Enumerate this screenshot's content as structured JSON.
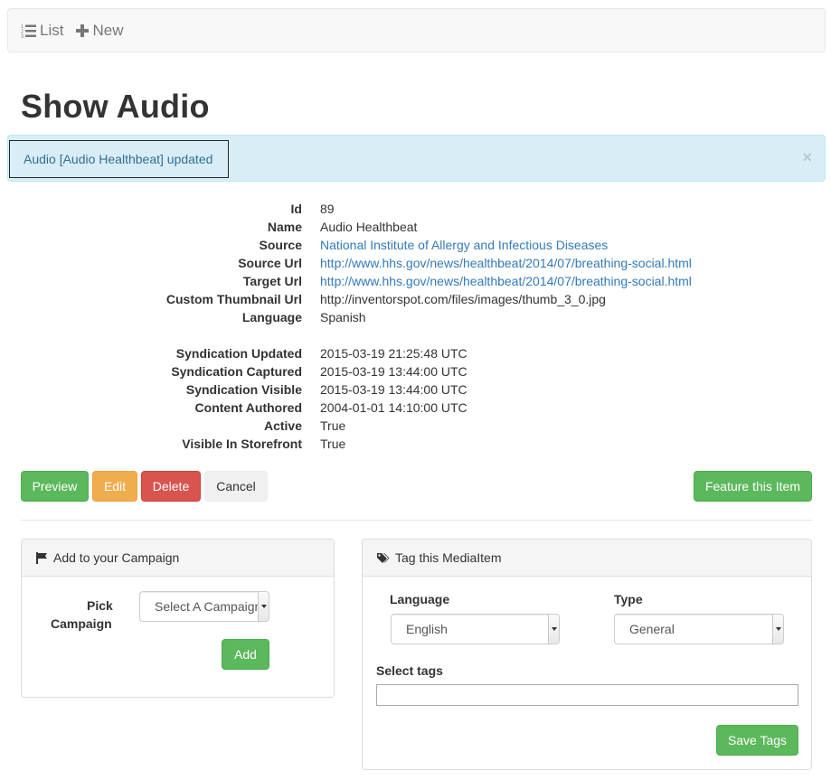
{
  "nav": {
    "list_label": "List",
    "new_label": "New"
  },
  "page_title": "Show Audio",
  "alert": {
    "message": "Audio [Audio Healthbeat] updated",
    "close_glyph": "×"
  },
  "details": [
    {
      "label": "Id",
      "value": "89"
    },
    {
      "label": "Name",
      "value": "Audio Healthbeat"
    },
    {
      "label": "Source",
      "value": "National Institute of Allergy and Infectious Diseases"
    },
    {
      "label": "Source Url",
      "value": "http://www.hhs.gov/news/healthbeat/2014/07/breathing-social.html"
    },
    {
      "label": "Target Url",
      "value": "http://www.hhs.gov/news/healthbeat/2014/07/breathing-social.html"
    },
    {
      "label": "Custom Thumbnail Url",
      "value": "http://inventorspot.com/files/images/thumb_3_0.jpg"
    },
    {
      "label": "Language",
      "value": "Spanish"
    },
    {
      "label": "Syndication Updated",
      "value": "2015-03-19 21:25:48 UTC"
    },
    {
      "label": "Syndication Captured",
      "value": "2015-03-19 13:44:00 UTC"
    },
    {
      "label": "Syndication Visible",
      "value": "2015-03-19 13:44:00 UTC"
    },
    {
      "label": "Content Authored",
      "value": "2004-01-01 14:10:00 UTC"
    },
    {
      "label": "Active",
      "value": "True"
    },
    {
      "label": "Visible In Storefront",
      "value": "True"
    }
  ],
  "actions": {
    "preview": "Preview",
    "edit": "Edit",
    "delete": "Delete",
    "cancel": "Cancel",
    "feature": "Feature this Item"
  },
  "campaign_panel": {
    "title": "Add to your Campaign",
    "pick_label_line1": "Pick",
    "pick_label_line2": "Campaign",
    "select_value": "Select A Campaign",
    "add_label": "Add"
  },
  "tag_panel": {
    "title": "Tag this MediaItem",
    "language_label": "Language",
    "language_value": "English",
    "type_label": "Type",
    "type_value": "General",
    "select_tags_label": "Select tags",
    "select_tags_value": "",
    "save_label": "Save Tags"
  },
  "colors": {
    "success": "#5cb85c",
    "warning": "#f0ad4e",
    "danger": "#d9534f",
    "link": "#337ab7",
    "alert_bg": "#d9edf7",
    "alert_text": "#31708f"
  }
}
